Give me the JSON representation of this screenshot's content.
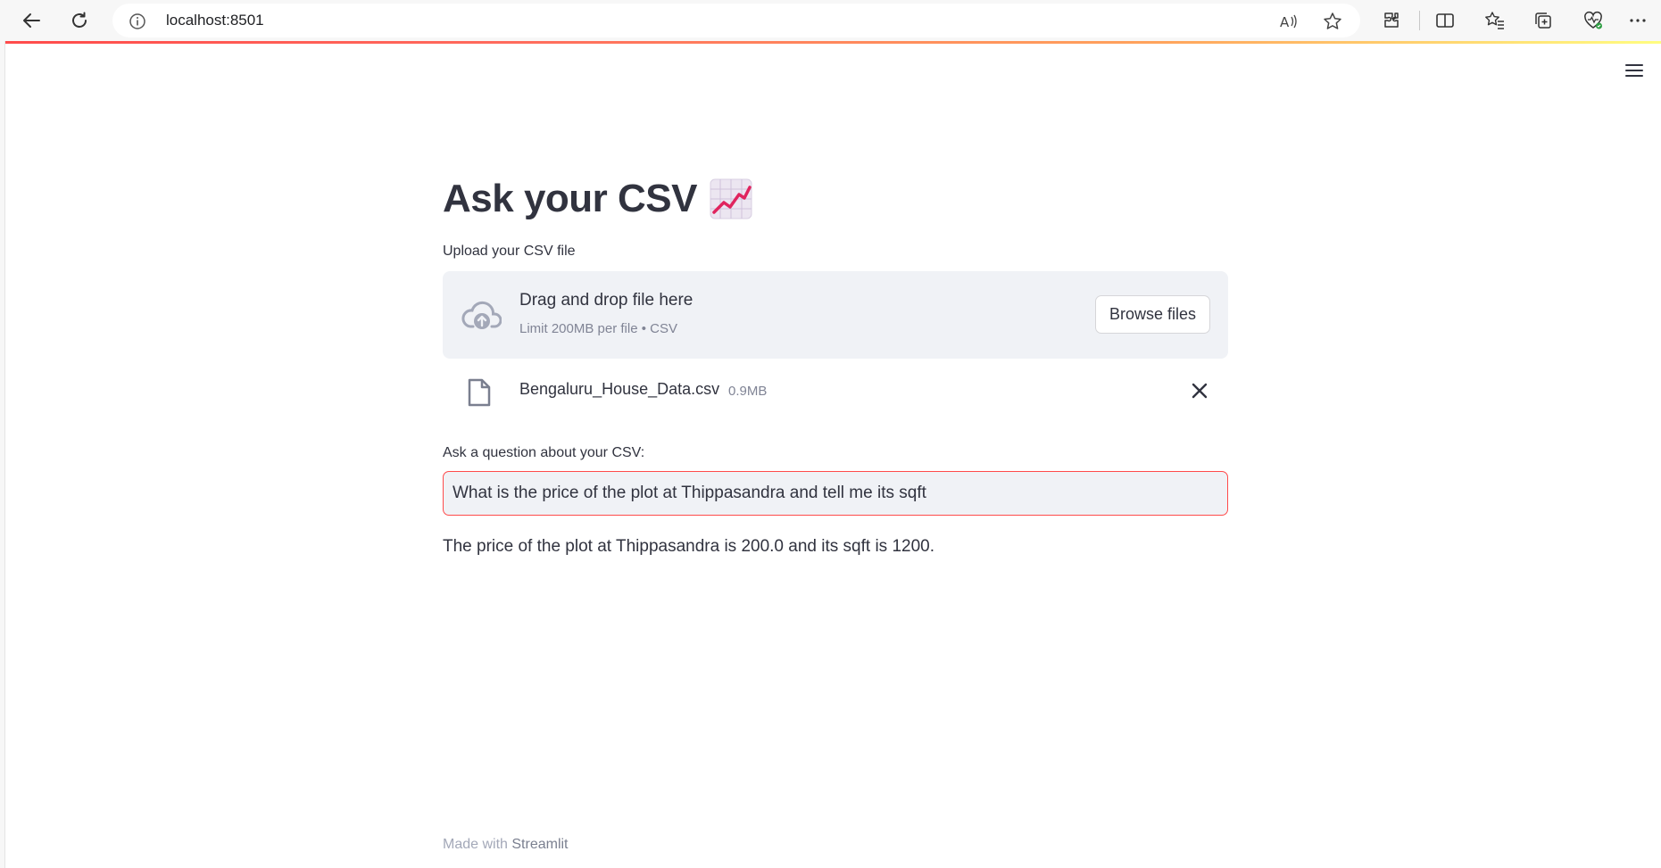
{
  "browser": {
    "url": "localhost:8501"
  },
  "app": {
    "title": "Ask your CSV",
    "title_icon": "chart-increasing-icon",
    "upload_label": "Upload your CSV file",
    "dropzone": {
      "main_text": "Drag and drop file here",
      "sub_text": "Limit 200MB per file • CSV",
      "browse_label": "Browse files"
    },
    "file": {
      "name": "Bengaluru_House_Data.csv",
      "size": "0.9MB"
    },
    "question_label": "Ask a question about your CSV:",
    "question_value": "What is the price of the plot at Thippasandra and tell me its sqft",
    "answer": "The price of the plot at Thippasandra is 200.0 and its sqft is 1200.",
    "footer": {
      "prefix": "Made with ",
      "brand": "Streamlit"
    }
  },
  "colors": {
    "accent": "#ff4b4b",
    "text": "#31333f",
    "dropzone_bg": "#f0f2f6",
    "muted": "#808495"
  }
}
